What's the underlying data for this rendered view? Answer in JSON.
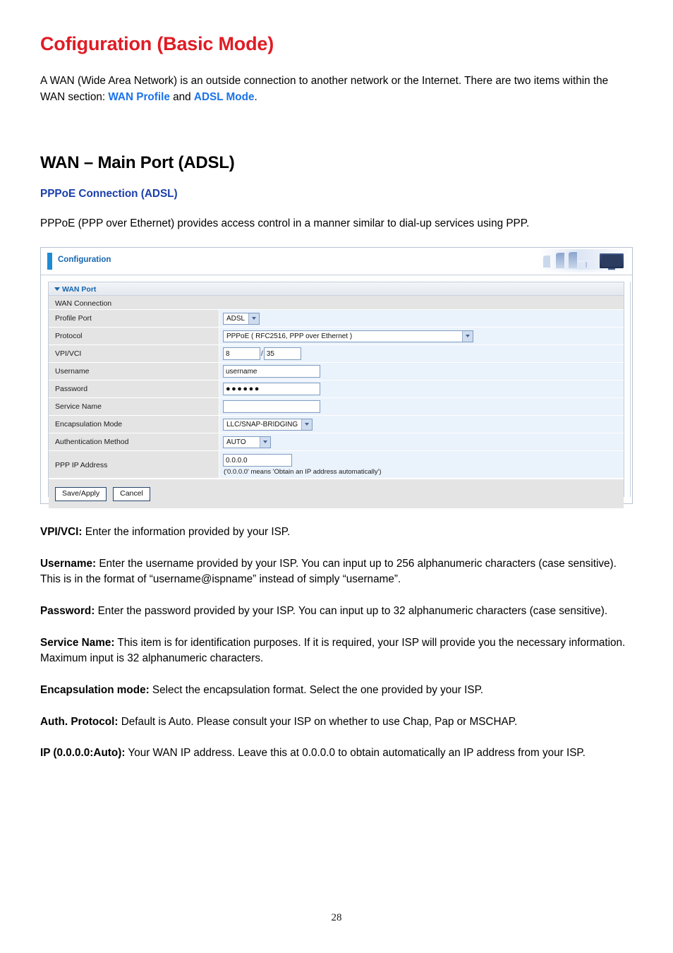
{
  "document": {
    "title": "Cofiguration (Basic Mode)",
    "intro": {
      "part1": "A WAN (Wide Area Network) is an outside connection to another network or the Internet. There are two items within the WAN section: ",
      "link1": "WAN Profile",
      "mid": " and ",
      "link2": "ADSL Mode",
      "end": "."
    },
    "section_heading": "WAN – Main Port (ADSL)",
    "sub_heading": "PPPoE Connection (ADSL)",
    "lead_paragraph": "PPPoE (PPP over Ethernet) provides access control in a manner similar to dial-up services using PPP.",
    "page_number": "28",
    "descriptions": [
      {
        "term": "VPI/VCI:",
        "text": " Enter the information provided by your ISP."
      },
      {
        "term": "Username:",
        "text": " Enter the username provided by your ISP. You can input up to 256 alphanumeric characters (case sensitive). This is in the format of “username@ispname” instead of simply “username”."
      },
      {
        "term": "Password:",
        "text": " Enter the password provided by your ISP. You can input up to 32 alphanumeric characters (case sensitive)."
      },
      {
        "term": "Service Name:",
        "text": " This item is for identification purposes. If it is required, your ISP will provide you the necessary information. Maximum input is 32 alphanumeric characters."
      },
      {
        "term": "Encapsulation mode:",
        "text": " Select the encapsulation format. Select the one provided by your ISP."
      },
      {
        "term": "Auth. Protocol:",
        "text": " Default is Auto. Please consult your ISP on whether to use Chap, Pap or MSCHAP."
      },
      {
        "term": "IP (0.0.0.0:Auto):",
        "text": " Your WAN IP address. Leave this at 0.0.0.0 to obtain automatically an IP address from your ISP."
      }
    ]
  },
  "router_ui": {
    "header_title": "Configuration",
    "hero_image": "office-scene-image",
    "wan_port_group": "WAN Port",
    "section_title": "WAN Connection",
    "fields": {
      "profile_port": {
        "label": "Profile Port",
        "value": "ADSL",
        "control": "select"
      },
      "protocol": {
        "label": "Protocol",
        "value": "PPPoE ( RFC2516, PPP over Ethernet )",
        "control": "select"
      },
      "vpi_vci": {
        "label": "VPI/VCI",
        "vpi": "8",
        "separator": "/",
        "vci": "35",
        "control": "text"
      },
      "username": {
        "label": "Username",
        "value": "username",
        "control": "text"
      },
      "password": {
        "label": "Password",
        "value": "●●●●●●",
        "control": "password"
      },
      "service_name": {
        "label": "Service Name",
        "value": "",
        "control": "text"
      },
      "encapsulation_mode": {
        "label": "Encapsulation Mode",
        "value": "LLC/SNAP-BRIDGING",
        "control": "select"
      },
      "authentication_method": {
        "label": "Authentication Method",
        "value": "AUTO",
        "control": "select"
      },
      "ppp_ip_address": {
        "label": "PPP IP Address",
        "value": "0.0.0.0",
        "hint": "('0.0.0.0' means 'Obtain an IP address automatically')",
        "control": "text"
      }
    },
    "buttons": {
      "save": "Save/Apply",
      "cancel": "Cancel"
    }
  },
  "colors": {
    "title_red": "#e01b24",
    "link_blue": "#1a73e8",
    "heading_blue": "#1a3faa",
    "ui_accent_blue": "#1e8bd4",
    "ui_label_gray": "#e4e4e4",
    "ui_value_blue": "#eaf2fb"
  }
}
